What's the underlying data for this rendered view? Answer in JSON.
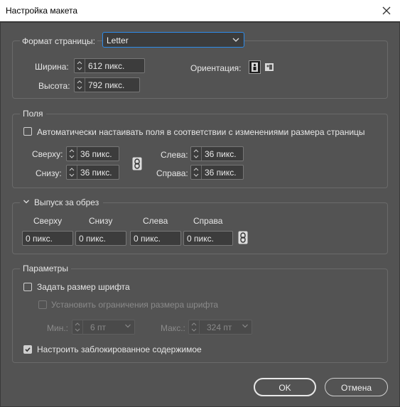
{
  "window": {
    "title": "Настройка макета"
  },
  "page_format": {
    "label": "Формат страницы:",
    "selected": "Letter"
  },
  "size": {
    "width_label": "Ширина:",
    "width_value": "612 пикс.",
    "height_label": "Высота:",
    "height_value": "792 пикс.",
    "orientation_label": "Ориентация:"
  },
  "margins": {
    "legend": "Поля",
    "auto_label": "Автоматически настаивать поля в соответствии с изменениями размера страницы",
    "top_label": "Сверху:",
    "top_value": "36 пикс.",
    "bottom_label": "Снизу:",
    "bottom_value": "36 пикс.",
    "left_label": "Слева:",
    "left_value": "36 пикс.",
    "right_label": "Справа:",
    "right_value": "36 пикс."
  },
  "bleed": {
    "legend": "Выпуск за обрез",
    "top_label": "Сверху",
    "top_value": "0 пикс.",
    "bottom_label": "Снизу",
    "bottom_value": "0 пикс.",
    "left_label": "Слева",
    "left_value": "0 пикс.",
    "right_label": "Справа",
    "right_value": "0 пикс."
  },
  "options": {
    "legend": "Параметры",
    "font_size_label": "Задать размер шрифта",
    "limits_label": "Установить ограничения размера шрифта",
    "min_label": "Мин.:",
    "min_value": "6 пт",
    "max_label": "Макс.:",
    "max_value": "324 пт",
    "locked_label": "Настроить заблокированное содержимое"
  },
  "buttons": {
    "ok": "OK",
    "cancel": "Отмена"
  },
  "colors": {
    "background": "#535353",
    "accent": "#2d8ceb",
    "field": "#3c3c3c"
  }
}
